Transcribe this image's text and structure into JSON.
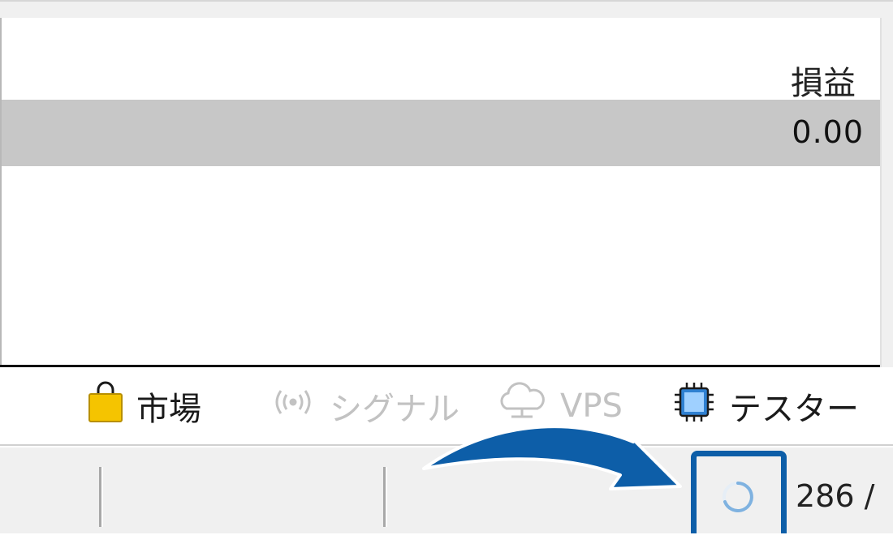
{
  "table": {
    "column_header": "損益",
    "selected_row_value": "0.00"
  },
  "tabs": [
    {
      "label": "市場",
      "icon": "shopping-bag-icon",
      "enabled": true
    },
    {
      "label": "シグナル",
      "icon": "signal-broadcast-icon",
      "enabled": false
    },
    {
      "label": "VPS",
      "icon": "cloud-icon",
      "enabled": false
    },
    {
      "label": "テスター",
      "icon": "cpu-chip-icon",
      "enabled": true
    }
  ],
  "statusbar": {
    "traffic_text": "286 /",
    "connection_indicator": "loading-spinner-icon"
  },
  "colors": {
    "selected_row": "#c7c7c7",
    "highlight": "#0d5ea8",
    "bag": "#f5c400",
    "chip": "#2f80d1"
  }
}
